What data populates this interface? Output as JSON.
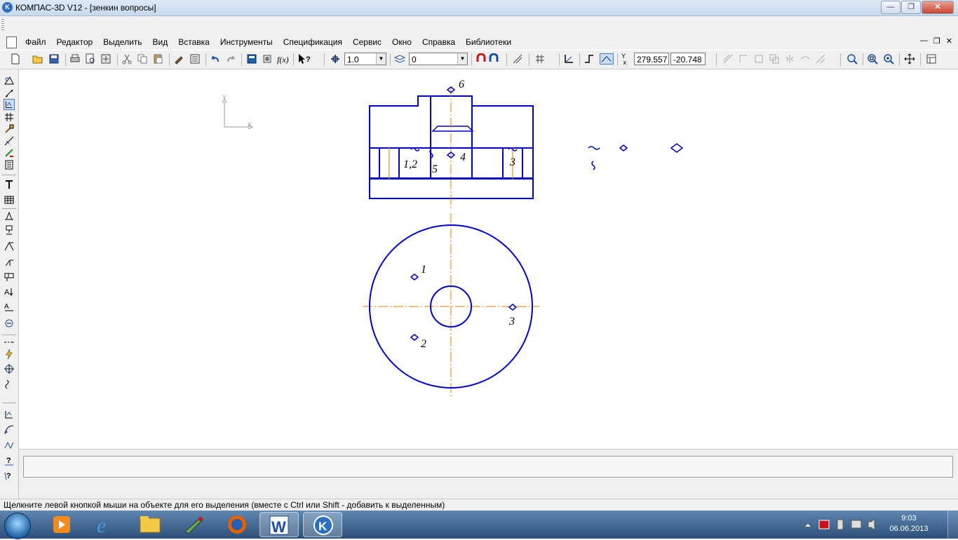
{
  "window": {
    "title": "КОМПАС-3D V12 - [зенкин вопросы]",
    "app_icon_letter": "K"
  },
  "menu": {
    "items": [
      "Файл",
      "Редактор",
      "Выделить",
      "Вид",
      "Вставка",
      "Инструменты",
      "Спецификация",
      "Сервис",
      "Окно",
      "Справка",
      "Библиотеки"
    ]
  },
  "toolbar": {
    "scale_value": "1.0",
    "layer_value": "0",
    "coord_x": "279.557",
    "coord_y": "-20.748",
    "icons": [
      "new-document-icon",
      "open-icon",
      "save-icon",
      "print-icon",
      "preview-icon",
      "print-setup-icon",
      "cut-icon",
      "copy-icon",
      "paste-icon",
      "format-brush-icon",
      "properties-icon",
      "undo-icon",
      "redo-icon",
      "manager-icon",
      "variables-icon",
      "function-icon",
      "help-pointer-icon",
      "scale-icon",
      "layers-icon",
      "magnet-icon",
      "snap-icon",
      "grid-icon",
      "local-cs-icon",
      "ortho-icon",
      "round-icon",
      "zoom-icon",
      "zoom-window-icon",
      "zoom-in-icon",
      "pan-icon",
      "view-icon"
    ]
  },
  "drawing": {
    "axis_labels": {
      "y": "Y",
      "x": "X"
    },
    "labels": {
      "front_top": "6",
      "front_left": "1,2",
      "front_mid5": "5",
      "front_mid4": "4",
      "front_right": "3",
      "plan_1": "1",
      "plan_2": "2",
      "plan_3": "3"
    },
    "colors": {
      "geometry": "#0000cd",
      "axis": "#e67e00",
      "text": "#000000"
    }
  },
  "command_panel": {
    "value": ""
  },
  "status": {
    "text": "Щелкните левой кнопкой мыши на объекте для его выделения (вместе с Ctrl или Shift - добавить к выделенным)"
  },
  "taskbar": {
    "time": "9:03",
    "date": "06.06.2013",
    "apps": [
      "media-player-icon",
      "internet-explorer-icon",
      "file-explorer-icon",
      "paint-icon",
      "firefox-icon",
      "word-icon",
      "kompas-icon"
    ]
  }
}
